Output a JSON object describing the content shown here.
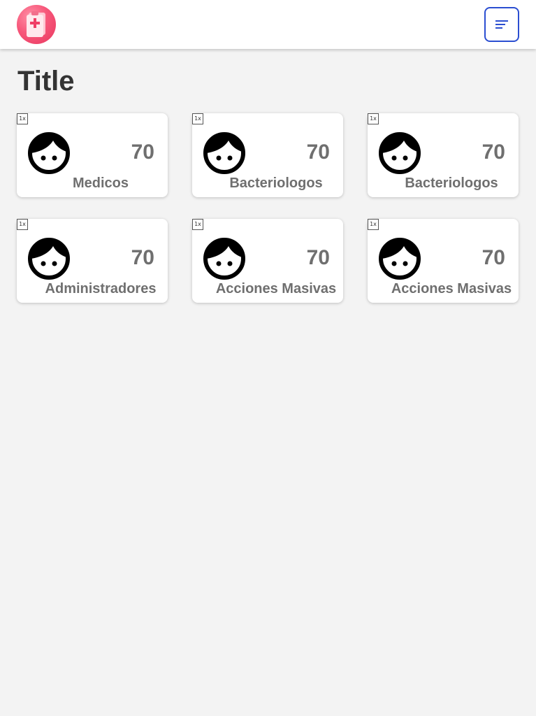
{
  "header": {
    "logo_icon": "medical-clipboard-icon",
    "menu_icon": "hamburger-menu-icon",
    "accent_color": "#2b4ed1",
    "logo_color": "#f7577a"
  },
  "page": {
    "title": "Title"
  },
  "cards": [
    {
      "image_placeholder": "1x",
      "icon": "face-icon",
      "count": "70",
      "label": "Medicos"
    },
    {
      "image_placeholder": "1x",
      "icon": "face-icon",
      "count": "70",
      "label": "Bacteriologos"
    },
    {
      "image_placeholder": "1x",
      "icon": "face-icon",
      "count": "70",
      "label": "Bacteriologos"
    },
    {
      "image_placeholder": "1x",
      "icon": "face-icon",
      "count": "70",
      "label": "Administradores"
    },
    {
      "image_placeholder": "1x",
      "icon": "face-icon",
      "count": "70",
      "label": "Acciones Masivas"
    },
    {
      "image_placeholder": "1x",
      "icon": "face-icon",
      "count": "70",
      "label": "Acciones Masivas"
    }
  ]
}
